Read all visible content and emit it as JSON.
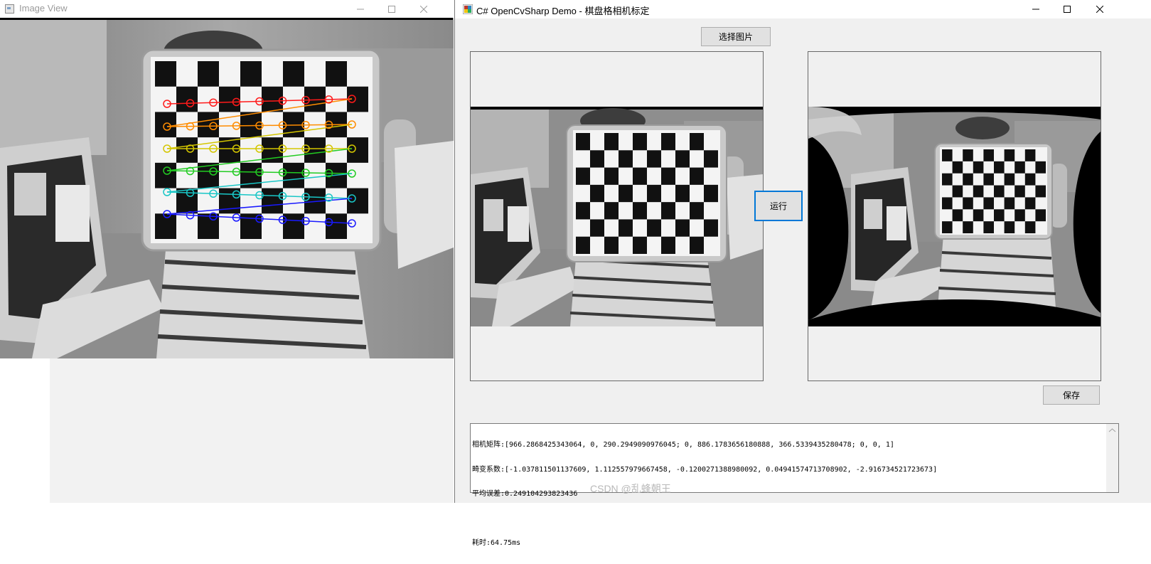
{
  "image_view": {
    "title": "Image View"
  },
  "demo": {
    "title": "C# OpenCvSharp Demo - 棋盘格相机标定",
    "select_button": "选择图片",
    "run_button": "运行",
    "save_button": "保存",
    "result_lines": [
      "相机矩阵:[966.2868425343064, 0, 290.2949090976045; 0, 886.1783656180888, 366.5339435280478; 0, 0, 1]",
      "畸变系数:[-1.037811501137609, 1.112557979667458, -0.1200271388980092, 0.04941574713708902, -2.916734521723673]",
      "平均误差:0.249104293823436",
      "",
      "耗时:64.75ms"
    ]
  },
  "watermark": "CSDN @乱蜂朝王",
  "colors": {
    "titlebar": "#ffffff",
    "window_bg": "#f0f0f0",
    "focus_border": "#0078d7",
    "button_bg": "#e1e1e1"
  }
}
